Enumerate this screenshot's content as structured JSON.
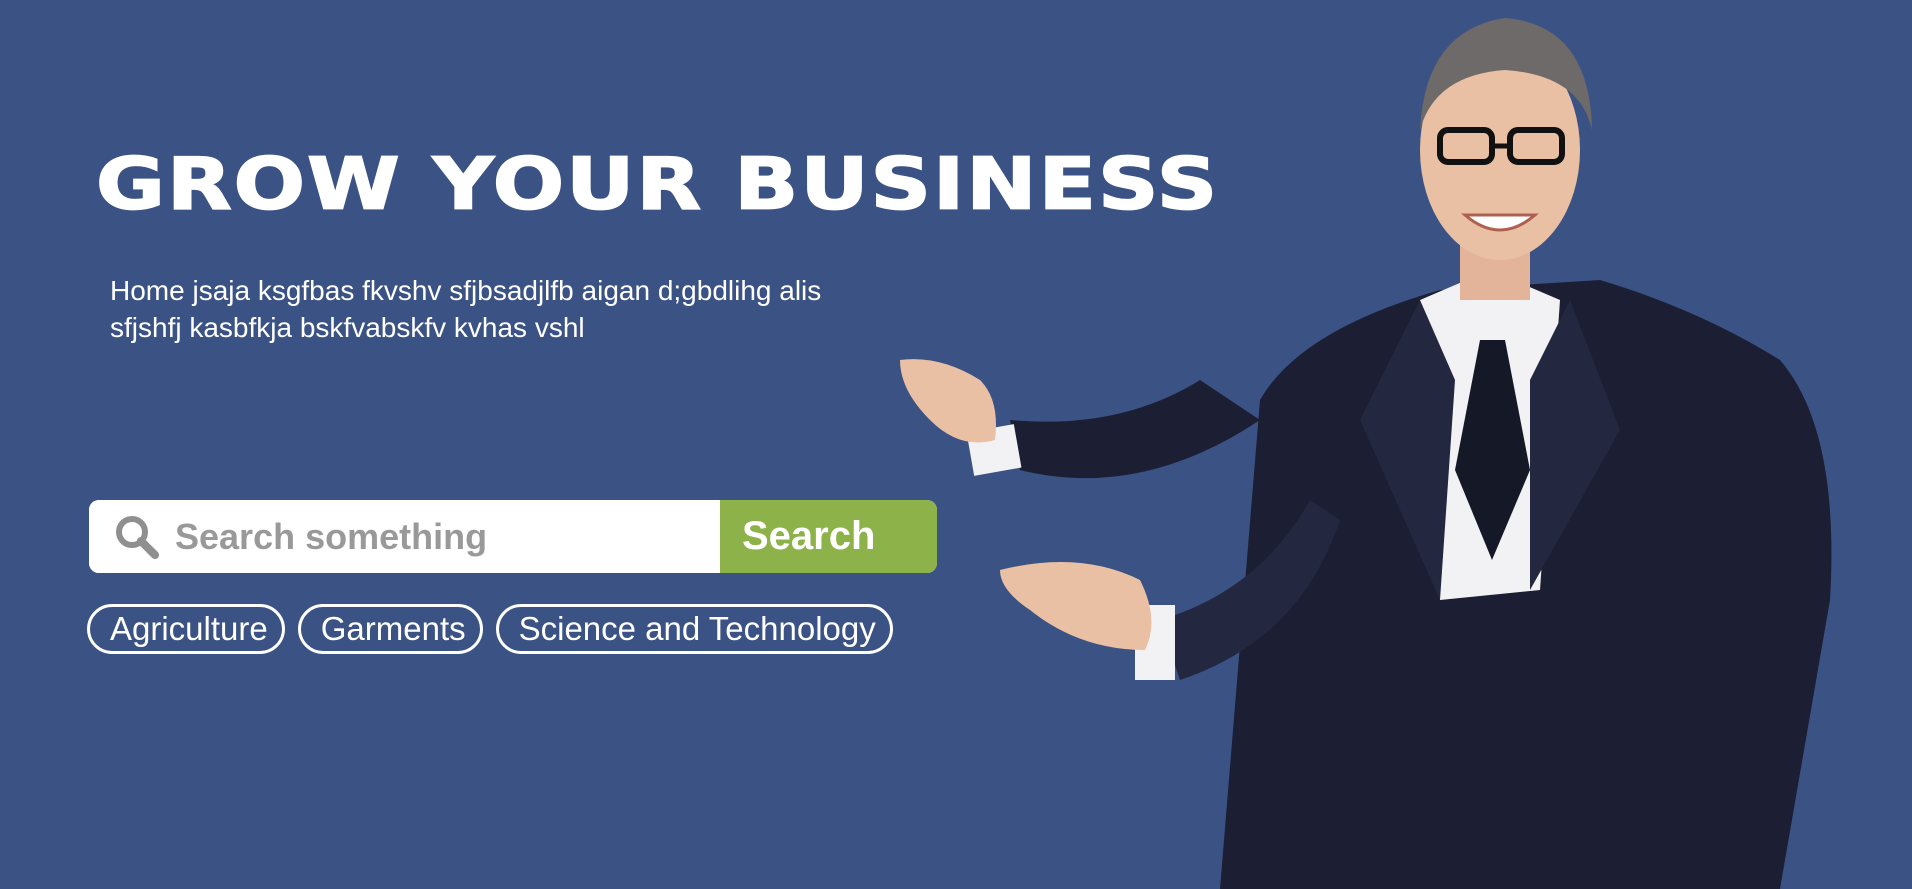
{
  "hero": {
    "headline": "GROW YOUR BUSINESS",
    "description_line1": "Home jsaja ksgfbas fkvshv sfjbsadjlfb aigan d;gbdlihg alis",
    "description_line2": "sfjshfj kasbfkja bskfvabskfv kvhas vshl"
  },
  "search": {
    "placeholder": "Search something",
    "button_label": "Search",
    "icon": "search-icon"
  },
  "categories": [
    {
      "label": "Agriculture"
    },
    {
      "label": "Garments"
    },
    {
      "label": "Science and Technology"
    }
  ],
  "colors": {
    "background": "#3b5285",
    "accent": "#8db24a",
    "text": "#ffffff",
    "placeholder": "#999999"
  }
}
